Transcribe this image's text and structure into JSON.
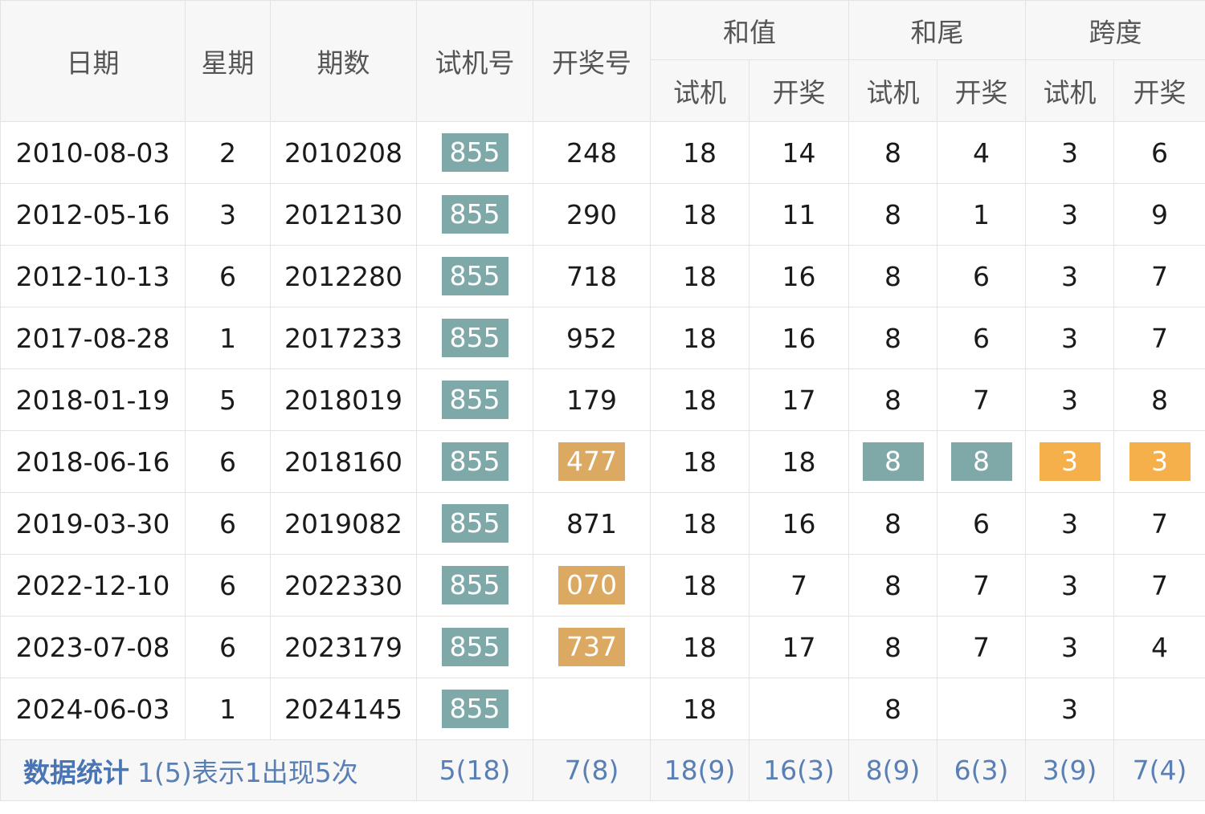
{
  "header": {
    "date": "日期",
    "weekday": "星期",
    "issue": "期数",
    "test_no": "试机号",
    "draw_no": "开奖号",
    "sum": "和值",
    "sum_tail": "和尾",
    "span": "跨度",
    "sub_test": "试机",
    "sub_draw": "开奖"
  },
  "colors": {
    "teal_badge": "#7fa8a9",
    "sand_badge": "#dba962",
    "orange_badge": "#f5b04b",
    "red_text": "#c0392b",
    "stat_text": "#5a7fb5"
  },
  "rows": [
    {
      "date": "2010-08-03",
      "weekday": "2",
      "issue": "2010208",
      "test": "855",
      "draw": "248",
      "sum_test": "18",
      "sum_draw": "14",
      "tail_test": "8",
      "tail_draw": "4",
      "span_test": "3",
      "span_draw": "6"
    },
    {
      "date": "2012-05-16",
      "weekday": "3",
      "issue": "2012130",
      "test": "855",
      "draw": "290",
      "sum_test": "18",
      "sum_draw": "11",
      "tail_test": "8",
      "tail_draw": "1",
      "span_test": "3",
      "span_draw": "9"
    },
    {
      "date": "2012-10-13",
      "weekday": "6",
      "issue": "2012280",
      "test": "855",
      "draw": "718",
      "sum_test": "18",
      "sum_draw": "16",
      "tail_test": "8",
      "tail_draw": "6",
      "span_test": "3",
      "span_draw": "7"
    },
    {
      "date": "2017-08-28",
      "weekday": "1",
      "issue": "2017233",
      "test": "855",
      "draw": "952",
      "sum_test": "18",
      "sum_draw": "16",
      "tail_test": "8",
      "tail_draw": "6",
      "span_test": "3",
      "span_draw": "7"
    },
    {
      "date": "2018-01-19",
      "weekday": "5",
      "issue": "2018019",
      "test": "855",
      "draw": "179",
      "sum_test": "18",
      "sum_draw": "17",
      "tail_test": "8",
      "tail_draw": "7",
      "span_test": "3",
      "span_draw": "8"
    },
    {
      "date": "2018-06-16",
      "weekday": "6",
      "issue": "2018160",
      "test": "855",
      "draw": "477",
      "sum_test": "18",
      "sum_draw": "18",
      "tail_test": "8",
      "tail_draw": "8",
      "span_test": "3",
      "span_draw": "3"
    },
    {
      "date": "2019-03-30",
      "weekday": "6",
      "issue": "2019082",
      "test": "855",
      "draw": "871",
      "sum_test": "18",
      "sum_draw": "16",
      "tail_test": "8",
      "tail_draw": "6",
      "span_test": "3",
      "span_draw": "7"
    },
    {
      "date": "2022-12-10",
      "weekday": "6",
      "issue": "2022330",
      "test": "855",
      "draw": "070",
      "sum_test": "18",
      "sum_draw": "7",
      "tail_test": "8",
      "tail_draw": "7",
      "span_test": "3",
      "span_draw": "7"
    },
    {
      "date": "2023-07-08",
      "weekday": "6",
      "issue": "2023179",
      "test": "855",
      "draw": "737",
      "sum_test": "18",
      "sum_draw": "17",
      "tail_test": "8",
      "tail_draw": "7",
      "span_test": "3",
      "span_draw": "4"
    },
    {
      "date": "2024-06-03",
      "weekday": "1",
      "issue": "2024145",
      "test": "855",
      "draw": "",
      "sum_test": "18",
      "sum_draw": "",
      "tail_test": "8",
      "tail_draw": "",
      "span_test": "3",
      "span_draw": ""
    }
  ],
  "footer": {
    "label": "数据统计",
    "note": "1(5)表示1出现5次",
    "test": "5(18)",
    "draw": "7(8)",
    "sum_test": "18(9)",
    "sum_draw": "16(3)",
    "tail_test": "8(9)",
    "tail_draw": "6(3)",
    "span_test": "3(9)",
    "span_draw": "7(4)"
  }
}
